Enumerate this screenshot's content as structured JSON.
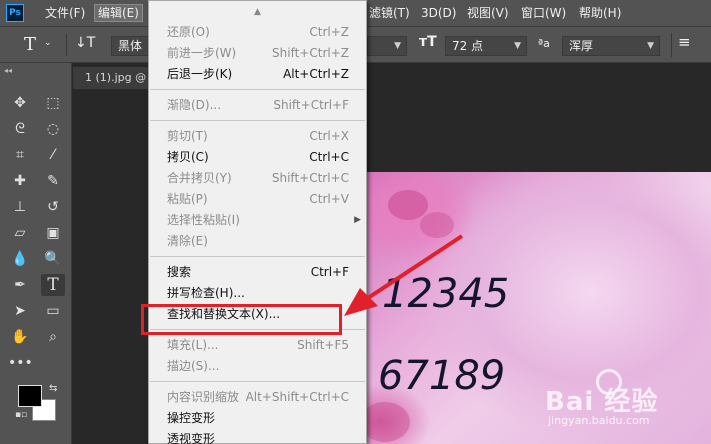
{
  "app": {
    "logo": "Ps"
  },
  "menubar": {
    "left_items": [
      {
        "label": "文件(F)"
      },
      {
        "label": "编辑(E)"
      }
    ],
    "right_items": [
      {
        "label": "滤镜(T)"
      },
      {
        "label": "3D(D)"
      },
      {
        "label": "视图(V)"
      },
      {
        "label": "窗口(W)"
      },
      {
        "label": "帮助(H)"
      }
    ]
  },
  "options": {
    "tool_glyph": "T",
    "font_family": "黑体",
    "font_size": "72 点",
    "aa_glyph": "ªa",
    "antialias": "浑厚"
  },
  "document": {
    "tab_title": "1 (1).jpg @"
  },
  "canvas": {
    "line1": "12345",
    "line2": "67189"
  },
  "watermark": {
    "brand": "Bai  经验",
    "url": "jingyan.baidu.com"
  },
  "edit_menu": {
    "scroll_up_glyph": "▲",
    "groups": [
      [
        {
          "label": "还原(O)",
          "shortcut": "Ctrl+Z",
          "enabled": false
        },
        {
          "label": "前进一步(W)",
          "shortcut": "Shift+Ctrl+Z",
          "enabled": false
        },
        {
          "label": "后退一步(K)",
          "shortcut": "Alt+Ctrl+Z",
          "enabled": true
        }
      ],
      [
        {
          "label": "渐隐(D)...",
          "shortcut": "Shift+Ctrl+F",
          "enabled": false
        }
      ],
      [
        {
          "label": "剪切(T)",
          "shortcut": "Ctrl+X",
          "enabled": false
        },
        {
          "label": "拷贝(C)",
          "shortcut": "Ctrl+C",
          "enabled": true
        },
        {
          "label": "合并拷贝(Y)",
          "shortcut": "Shift+Ctrl+C",
          "enabled": false
        },
        {
          "label": "粘贴(P)",
          "shortcut": "Ctrl+V",
          "enabled": false
        },
        {
          "label": "选择性粘贴(I)",
          "shortcut": "",
          "enabled": false,
          "submenu": true
        },
        {
          "label": "清除(E)",
          "shortcut": "",
          "enabled": false
        }
      ],
      [
        {
          "label": "搜索",
          "shortcut": "Ctrl+F",
          "enabled": true
        },
        {
          "label": "拼写检查(H)...",
          "shortcut": "",
          "enabled": true
        },
        {
          "label": "查找和替换文本(X)...",
          "shortcut": "",
          "enabled": true,
          "highlighted": true
        }
      ],
      [
        {
          "label": "填充(L)...",
          "shortcut": "Shift+F5",
          "enabled": false
        },
        {
          "label": "描边(S)...",
          "shortcut": "",
          "enabled": false
        }
      ],
      [
        {
          "label": "内容识别缩放",
          "shortcut": "Alt+Shift+Ctrl+C",
          "enabled": false
        },
        {
          "label": "操控变形",
          "shortcut": "",
          "enabled": true
        },
        {
          "label": "透视变形",
          "shortcut": "",
          "enabled": true
        }
      ]
    ]
  },
  "colors": {
    "highlight": "#e0202a",
    "menu_bg": "#f0f0f0",
    "chrome": "#535353"
  }
}
